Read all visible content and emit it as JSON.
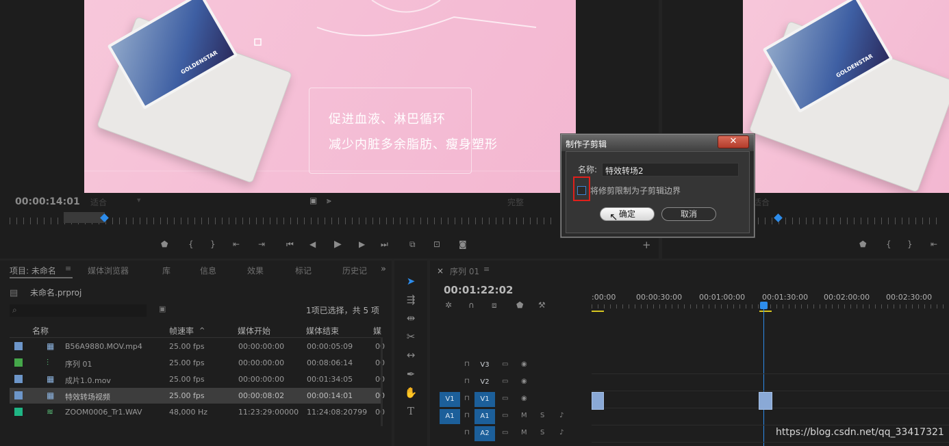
{
  "source_monitor": {
    "timecode": "00:00:14:01",
    "fit_dropdown": "适合",
    "quality_dropdown": "完整",
    "frame_text_line1": "促进血液、淋巴循环",
    "frame_text_line2": "减少内脏多余脂肪、瘦身塑形",
    "device_brand": "GOLDENSTAR"
  },
  "program_monitor": {
    "fit_dropdown": "适合",
    "device_brand": "GOLDENSTAR"
  },
  "dialog": {
    "title": "制作子剪辑",
    "close_glyph": "✕",
    "name_label": "名称:",
    "name_value": "特效转场2",
    "checkbox_label": "将修剪限制为子剪辑边界",
    "checkbox_checked": false,
    "ok_label": "确定",
    "cancel_label": "取消"
  },
  "project_panel": {
    "tabs": [
      "项目: 未命名",
      "媒体浏览器",
      "库",
      "信息",
      "效果",
      "标记",
      "历史记"
    ],
    "project_file": "未命名.prproj",
    "selection_status": "1项已选择，共 5 项",
    "columns": [
      "名称",
      "帧速率",
      "媒体开始",
      "媒体结束",
      "媒"
    ],
    "sort_indicator": "^",
    "rows": [
      {
        "name": "B56A9880.MOV.mp4",
        "fps": "25.00 fps",
        "start": "00:00:00:00",
        "end": "00:00:05:09",
        "extra": "00",
        "color": "#6d96c9",
        "selected": false,
        "icon": "video"
      },
      {
        "name": "序列 01",
        "fps": "25.00 fps",
        "start": "00:00:00:00",
        "end": "00:08:06:14",
        "extra": "00",
        "color": "#45a74a",
        "selected": false,
        "icon": "sequence"
      },
      {
        "name": "成片1.0.mov",
        "fps": "25.00 fps",
        "start": "00:00:00:00",
        "end": "00:01:34:05",
        "extra": "00",
        "color": "#6d96c9",
        "selected": false,
        "icon": "video"
      },
      {
        "name": "特效转场视频",
        "fps": "25.00 fps",
        "start": "00:00:08:02",
        "end": "00:00:14:01",
        "extra": "00",
        "color": "#6d96c9",
        "selected": true,
        "icon": "video"
      },
      {
        "name": "ZOOM0006_Tr1.WAV",
        "fps": "48,000 Hz",
        "start": "11:23:29:00000",
        "end": "11:24:08:20799",
        "extra": "00",
        "color": "#1fb584",
        "selected": false,
        "icon": "audio"
      }
    ]
  },
  "timeline": {
    "tab_label": "序列 01",
    "close_glyph": "×",
    "timecode": "00:01:22:02",
    "ruler_labels": [
      ":00:00",
      "00:00:30:00",
      "00:01:00:00",
      "00:01:30:00",
      "00:02:00:00",
      "00:02:30:00"
    ],
    "tracks": [
      {
        "id": "V3",
        "source": ""
      },
      {
        "id": "V2",
        "source": ""
      },
      {
        "id": "V1",
        "source": "V1"
      },
      {
        "id": "A1",
        "source": "A1"
      },
      {
        "id": "A2",
        "source": ""
      }
    ]
  },
  "watermark": "https://blog.csdn.net/qq_33417321",
  "colors": {
    "accent": "#2d8ceb",
    "highlight_box": "#e0201b",
    "clip": "#8aa9d6"
  }
}
